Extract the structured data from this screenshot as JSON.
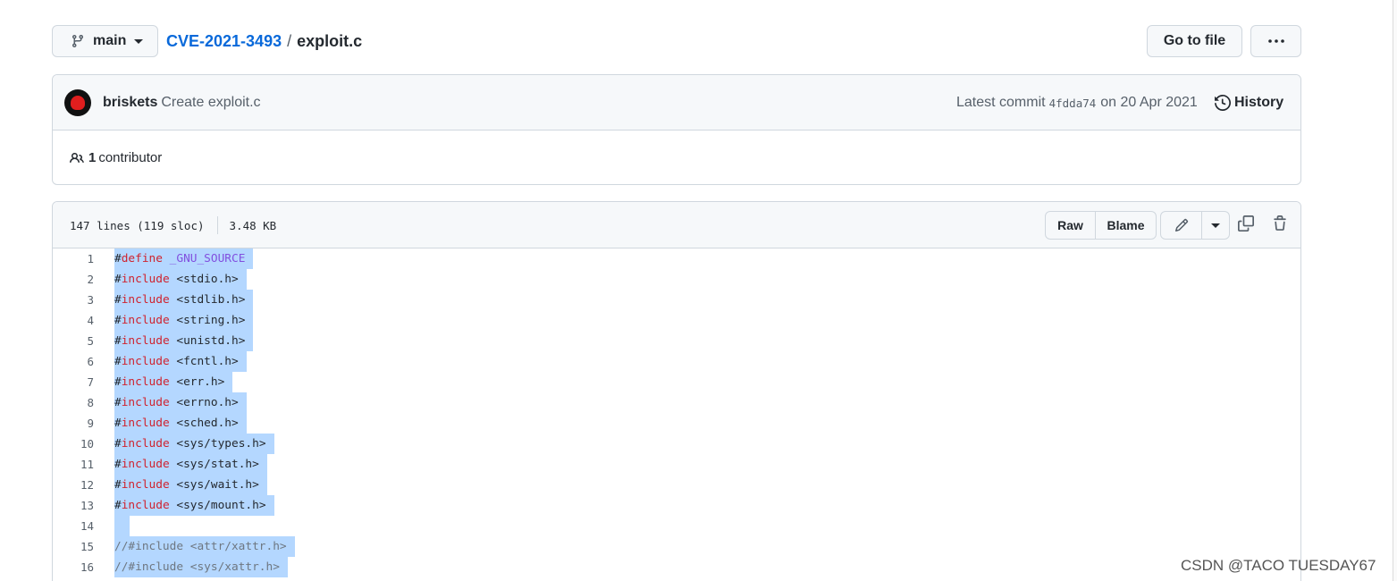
{
  "branch": {
    "label": "main"
  },
  "breadcrumb": {
    "repo": "CVE-2021-3493",
    "separator": "/",
    "file": "exploit.c"
  },
  "toolbar": {
    "goto_label": "Go to file",
    "more_label": "···"
  },
  "commit": {
    "author": "briskets",
    "message": "Create exploit.c",
    "latest_prefix": "Latest commit",
    "sha": "4fdda74",
    "date": "on 20 Apr 2021",
    "history_label": "History"
  },
  "contributors": {
    "count": "1",
    "label": "contributor"
  },
  "file_header": {
    "lines_info": "147 lines (119 sloc)",
    "size": "3.48 KB",
    "raw_label": "Raw",
    "blame_label": "Blame"
  },
  "code_lines": [
    {
      "num": "1",
      "hash": "#",
      "kw": "define",
      "rest": " _GNU_SOURCE",
      "restClass": "pp"
    },
    {
      "num": "2",
      "hash": "#",
      "kw": "include",
      "rest": " <stdio.h>"
    },
    {
      "num": "3",
      "hash": "#",
      "kw": "include",
      "rest": " <stdlib.h>"
    },
    {
      "num": "4",
      "hash": "#",
      "kw": "include",
      "rest": " <string.h>"
    },
    {
      "num": "5",
      "hash": "#",
      "kw": "include",
      "rest": " <unistd.h>"
    },
    {
      "num": "6",
      "hash": "#",
      "kw": "include",
      "rest": " <fcntl.h>"
    },
    {
      "num": "7",
      "hash": "#",
      "kw": "include",
      "rest": " <err.h>"
    },
    {
      "num": "8",
      "hash": "#",
      "kw": "include",
      "rest": " <errno.h>"
    },
    {
      "num": "9",
      "hash": "#",
      "kw": "include",
      "rest": " <sched.h>"
    },
    {
      "num": "10",
      "hash": "#",
      "kw": "include",
      "rest": " <sys/types.h>"
    },
    {
      "num": "11",
      "hash": "#",
      "kw": "include",
      "rest": " <sys/stat.h>"
    },
    {
      "num": "12",
      "hash": "#",
      "kw": "include",
      "rest": " <sys/wait.h>"
    },
    {
      "num": "13",
      "hash": "#",
      "kw": "include",
      "rest": " <sys/mount.h>"
    },
    {
      "num": "14",
      "hash": "",
      "kw": "",
      "rest": " "
    },
    {
      "num": "15",
      "hash": "",
      "kw": "",
      "rest": "//#include <attr/xattr.h>",
      "restClass": "cm"
    },
    {
      "num": "16",
      "hash": "",
      "kw": "",
      "rest": "//#include <sys/xattr.h>",
      "restClass": "cm"
    }
  ],
  "watermark": "CSDN @TACO TUESDAY67"
}
